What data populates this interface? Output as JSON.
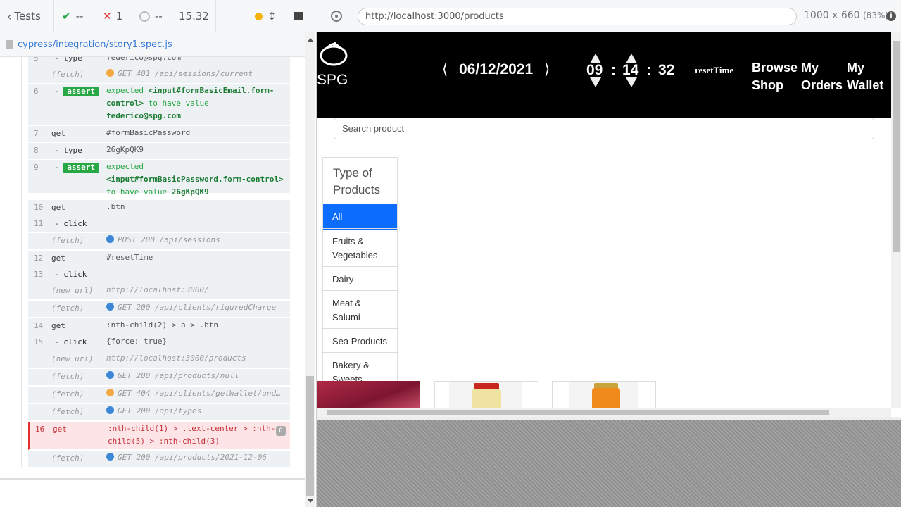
{
  "reporter": {
    "tests_label": "Tests",
    "passed": "--",
    "failed": "1",
    "pending": "--",
    "duration": "15.32",
    "spec_path": "cypress/integration/story1.spec.js"
  },
  "commands": [
    {
      "num": "5",
      "name": "- type",
      "msg": "federico@spg.com",
      "kind": "sub"
    },
    {
      "num": "",
      "name": "(fetch)",
      "msg": "GET 401 /api/sessions/current",
      "kind": "ev",
      "dot": "orange"
    },
    {
      "num": "6",
      "name": "assert",
      "kind": "assert",
      "msg_parts": [
        "expected",
        "<input#formBasicEmail.form-control>",
        "to have value",
        "federico@spg.com"
      ]
    },
    {
      "num": "7",
      "name": "get",
      "msg": "#formBasicPassword",
      "kind": "cmd"
    },
    {
      "num": "8",
      "name": "- type",
      "msg": "26gKpQK9",
      "kind": "sub"
    },
    {
      "num": "9",
      "name": "assert",
      "kind": "assert",
      "msg_parts": [
        "expected",
        "<input#formBasicPassword.form-control>",
        "to have value",
        "26gKpQK9"
      ]
    },
    {
      "num": "10",
      "name": "get",
      "msg": ".btn",
      "kind": "cmd"
    },
    {
      "num": "11",
      "name": "- click",
      "msg": "",
      "kind": "sub"
    },
    {
      "num": "",
      "name": "(fetch)",
      "msg": "POST 200 /api/sessions",
      "kind": "ev",
      "dot": "blue"
    },
    {
      "num": "12",
      "name": "get",
      "msg": "#resetTime",
      "kind": "cmd"
    },
    {
      "num": "13",
      "name": "- click",
      "msg": "",
      "kind": "sub"
    },
    {
      "num": "",
      "name": "(new url)",
      "msg": "http://localhost:3000/",
      "kind": "ev"
    },
    {
      "num": "",
      "name": "(fetch)",
      "msg": "GET 200 /api/clients/riquredCharge",
      "kind": "ev",
      "dot": "blue"
    },
    {
      "num": "14",
      "name": "get",
      "msg": ":nth-child(2) > a > .btn",
      "kind": "cmd"
    },
    {
      "num": "15",
      "name": "- click",
      "msg": "{force: true}",
      "kind": "sub"
    },
    {
      "num": "",
      "name": "(new url)",
      "msg": "http://localhost:3000/products",
      "kind": "ev"
    },
    {
      "num": "",
      "name": "(fetch)",
      "msg": "GET 200 /api/products/null",
      "kind": "ev",
      "dot": "blue"
    },
    {
      "num": "",
      "name": "(fetch)",
      "msg": "GET 404 /api/clients/getWallet/und…",
      "kind": "ev",
      "dot": "orange"
    },
    {
      "num": "",
      "name": "(fetch)",
      "msg": "GET 200 /api/types",
      "kind": "ev",
      "dot": "blue"
    },
    {
      "num": "16",
      "name": "get",
      "msg": ":nth-child(1) > .text-center > :nth-child(5) > :nth-child(3)",
      "kind": "failed",
      "badge": "0"
    },
    {
      "num": "",
      "name": "(fetch)",
      "msg": "GET 200 /api/products/2021-12-06",
      "kind": "ev",
      "dot": "blue"
    }
  ],
  "aut": {
    "url": "http://localhost:3000/products",
    "viewport": "1000 x 660",
    "scale": "(83%)"
  },
  "app": {
    "brand": "SPG",
    "date": "06/12/2021",
    "hours": "09",
    "minutes": "14",
    "seconds": "32",
    "time_sep": ":",
    "reset_label": "resetTime",
    "nav": [
      "Browse Shop",
      "My Orders",
      "My Wallet"
    ],
    "search_placeholder": "Search product",
    "types_heading": "Type of Products",
    "types": [
      "All",
      "Fruits & Vegetables",
      "Dairy",
      "Meat & Salumi",
      "Sea Products",
      "Bakery & Sweets"
    ],
    "active_type": "All"
  },
  "colors": {
    "pass": "#27a844",
    "fail": "#e2302f",
    "link": "#3779d6",
    "active_type": "#0d6efd",
    "navbar": "#000000"
  }
}
